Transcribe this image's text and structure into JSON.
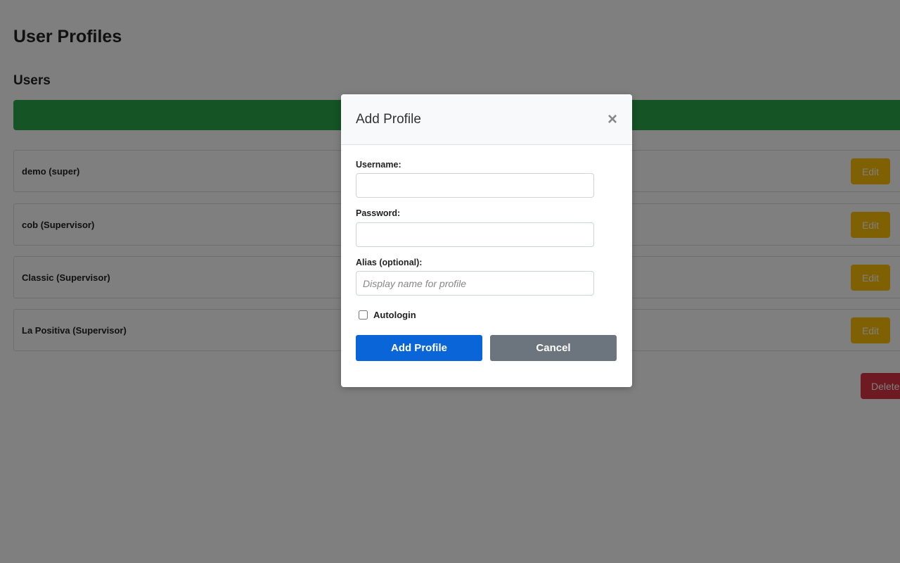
{
  "page": {
    "title": "User Profiles",
    "section_title": "Users",
    "add_bar_label": ""
  },
  "users": [
    {
      "name": "demo (super)",
      "edit_label": "Edit"
    },
    {
      "name": "cob (Supervisor)",
      "edit_label": "Edit"
    },
    {
      "name": "Classic (Supervisor)",
      "edit_label": "Edit"
    },
    {
      "name": "La Positiva (Supervisor)",
      "edit_label": "Edit"
    }
  ],
  "delete_label": "Delete",
  "modal": {
    "title": "Add Profile",
    "close_glyph": "×",
    "username_label": "Username:",
    "username_value": "",
    "password_label": "Password:",
    "password_value": "",
    "alias_label": "Alias (optional):",
    "alias_placeholder": "Display name for profile",
    "autologin_label": "Autologin",
    "autologin_checked": false,
    "submit_label": "Add Profile",
    "cancel_label": "Cancel"
  },
  "colors": {
    "add_bar": "#2aa84a",
    "edit": "#ffc107",
    "delete": "#dc3545",
    "primary": "#0a66d8",
    "secondary": "#6c757d"
  }
}
